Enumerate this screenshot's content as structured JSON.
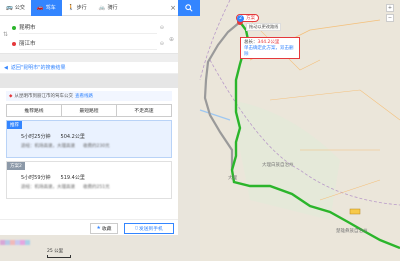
{
  "topbar": {
    "tabs": [
      {
        "label": "公交",
        "icon": "bus-icon"
      },
      {
        "label": "驾车",
        "icon": "car-icon"
      },
      {
        "label": "步行",
        "icon": "walk-icon"
      },
      {
        "label": "骑行",
        "icon": "bike-icon"
      }
    ],
    "active_tab": "驾车"
  },
  "route": {
    "start": "昆明市",
    "end": "丽江市"
  },
  "back_link": "返回\"昆明市\"的搜索结果",
  "notice": {
    "text": "从昆明市到丽江市的驾车公交",
    "link": "查看线路"
  },
  "preference_tabs": [
    "推荐路线",
    "最短路程",
    "不走高速"
  ],
  "routes": [
    {
      "badge": "推荐",
      "time": "5小时25分钟",
      "distance": "504.2公里",
      "via": "途经：机场高速，大理高速",
      "toll": "收费约230元"
    },
    {
      "badge": "方案2",
      "time": "5小时59分钟",
      "distance": "519.4公里",
      "via": "途经：机场高速，大理高速",
      "toll": "收费约251元"
    }
  ],
  "buttons": {
    "favorite": "收藏",
    "send_to_phone": "发送到手机"
  },
  "map": {
    "plan_marker": {
      "num": "2",
      "label": "方案"
    },
    "drag_hint": "拖动以更改路线",
    "info": {
      "line1_prefix": "总长：",
      "distance": "344.2公里",
      "line2": "单击确定此方案，双击删除"
    },
    "labels": {
      "dali": "大理白族自治州",
      "dali_city": "大理",
      "chuxiong": "楚雄彝族自治州"
    },
    "scale": "25 公里",
    "colors": {
      "route_main": "#2bb52b",
      "route_alt": "#999999"
    }
  }
}
